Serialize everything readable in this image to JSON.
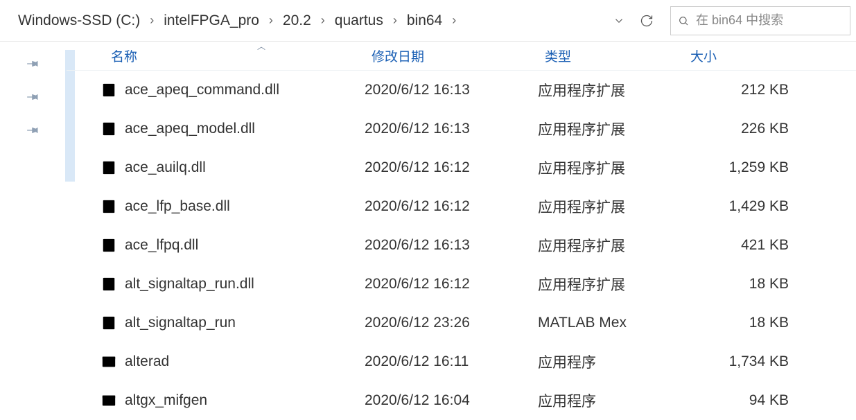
{
  "breadcrumb": {
    "segments": [
      "Windows-SSD (C:)",
      "intelFPGA_pro",
      "20.2",
      "quartus",
      "bin64"
    ]
  },
  "search": {
    "placeholder": "在 bin64 中搜索"
  },
  "columns": {
    "name": "名称",
    "date": "修改日期",
    "type": "类型",
    "size": "大小"
  },
  "files": [
    {
      "icon": "dll",
      "name": "ace_apeq_command.dll",
      "date": "2020/6/12 16:13",
      "type": "应用程序扩展",
      "size": "212 KB"
    },
    {
      "icon": "dll",
      "name": "ace_apeq_model.dll",
      "date": "2020/6/12 16:13",
      "type": "应用程序扩展",
      "size": "226 KB"
    },
    {
      "icon": "dll",
      "name": "ace_auilq.dll",
      "date": "2020/6/12 16:12",
      "type": "应用程序扩展",
      "size": "1,259 KB"
    },
    {
      "icon": "dll",
      "name": "ace_lfp_base.dll",
      "date": "2020/6/12 16:12",
      "type": "应用程序扩展",
      "size": "1,429 KB"
    },
    {
      "icon": "dll",
      "name": "ace_lfpq.dll",
      "date": "2020/6/12 16:13",
      "type": "应用程序扩展",
      "size": "421 KB"
    },
    {
      "icon": "dll",
      "name": "alt_signaltap_run.dll",
      "date": "2020/6/12 16:12",
      "type": "应用程序扩展",
      "size": "18 KB"
    },
    {
      "icon": "mex",
      "name": "alt_signaltap_run",
      "date": "2020/6/12 23:26",
      "type": "MATLAB Mex",
      "size": "18 KB"
    },
    {
      "icon": "exe",
      "name": "alterad",
      "date": "2020/6/12 16:11",
      "type": "应用程序",
      "size": "1,734 KB"
    },
    {
      "icon": "exe",
      "name": "altgx_mifgen",
      "date": "2020/6/12 16:04",
      "type": "应用程序",
      "size": "94 KB"
    }
  ]
}
